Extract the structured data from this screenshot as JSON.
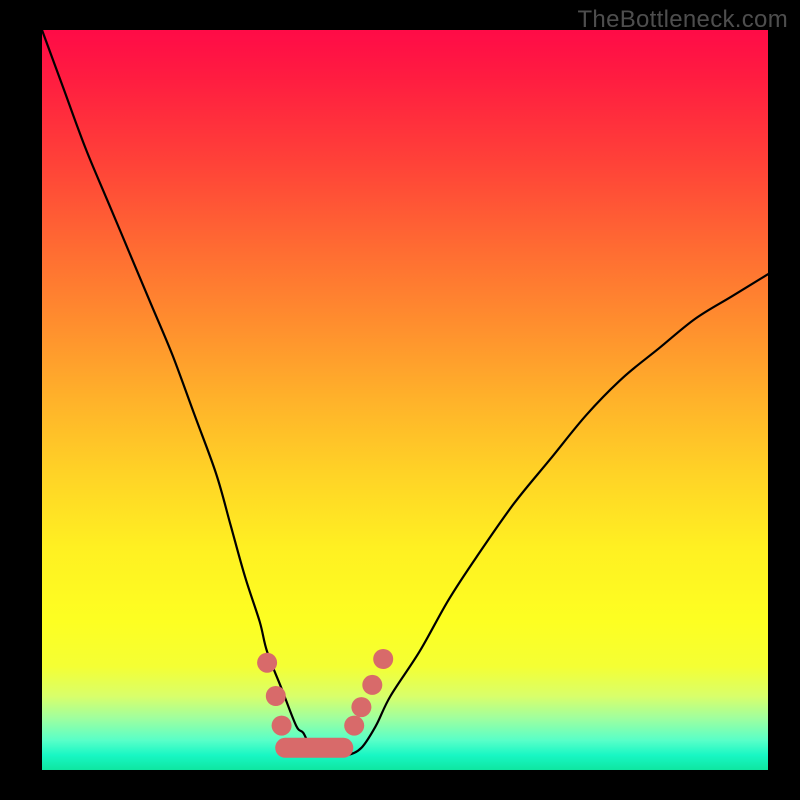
{
  "watermark": "TheBottleneck.com",
  "colors": {
    "dot": "#d86a6a",
    "curve": "#000000",
    "frame": "#000000"
  },
  "chart_data": {
    "type": "line",
    "title": "",
    "xlabel": "",
    "ylabel": "",
    "xlim": [
      0,
      100
    ],
    "ylim": [
      0,
      100
    ],
    "series": [
      {
        "name": "bottleneck-curve",
        "x": [
          0,
          3,
          6,
          9,
          12,
          15,
          18,
          21,
          24,
          26,
          28,
          30,
          31,
          33,
          35,
          36,
          37,
          38,
          40,
          42,
          44,
          46,
          48,
          52,
          56,
          60,
          65,
          70,
          75,
          80,
          85,
          90,
          95,
          100
        ],
        "values": [
          100,
          92,
          84,
          77,
          70,
          63,
          56,
          48,
          40,
          33,
          26,
          20,
          16,
          11,
          6,
          5,
          3,
          2,
          2,
          2,
          3,
          6,
          10,
          16,
          23,
          29,
          36,
          42,
          48,
          53,
          57,
          61,
          64,
          67
        ]
      }
    ],
    "markers": [
      {
        "x": 31.0,
        "y": 14.5
      },
      {
        "x": 32.2,
        "y": 10.0
      },
      {
        "x": 33.0,
        "y": 6.0
      },
      {
        "x": 43.0,
        "y": 6.0
      },
      {
        "x": 44.0,
        "y": 8.5
      },
      {
        "x": 45.5,
        "y": 11.5
      },
      {
        "x": 47.0,
        "y": 15.0
      }
    ],
    "flat_segment": {
      "x_start": 33.5,
      "x_end": 41.5,
      "y": 3.0
    },
    "annotations": []
  }
}
